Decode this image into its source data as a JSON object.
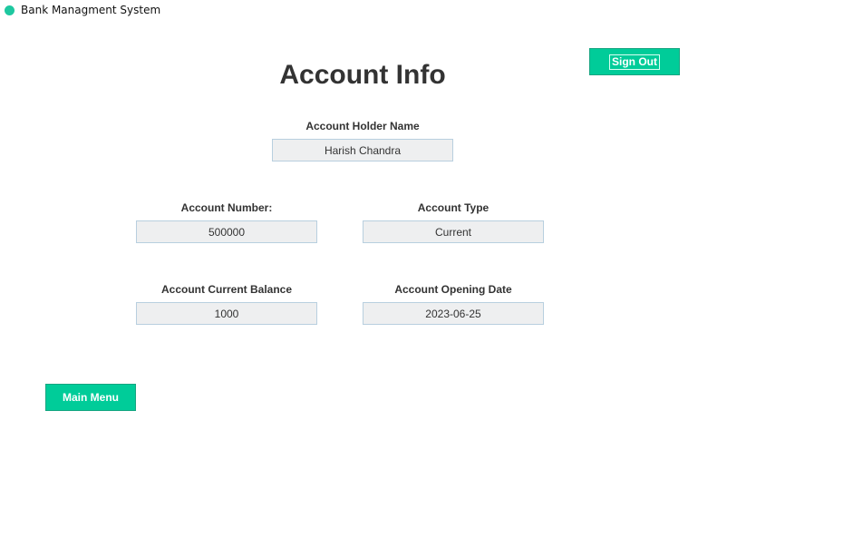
{
  "window": {
    "title": "Bank Managment System",
    "app_icon": "green-circle-icon",
    "accent_color": "#00cc99"
  },
  "page": {
    "title": "Account Info",
    "sign_out_label": "Sign Out",
    "main_menu_label": "Main Menu"
  },
  "fields": {
    "holder_name": {
      "label": "Account Holder Name",
      "value": "Harish Chandra"
    },
    "account_number": {
      "label": "Account Number:",
      "value": "500000"
    },
    "account_type": {
      "label": "Account Type",
      "value": "Current"
    },
    "current_balance": {
      "label": "Account Current Balance",
      "value": "1000"
    },
    "opening_date": {
      "label": "Account Opening Date",
      "value": "2023-06-25"
    }
  }
}
